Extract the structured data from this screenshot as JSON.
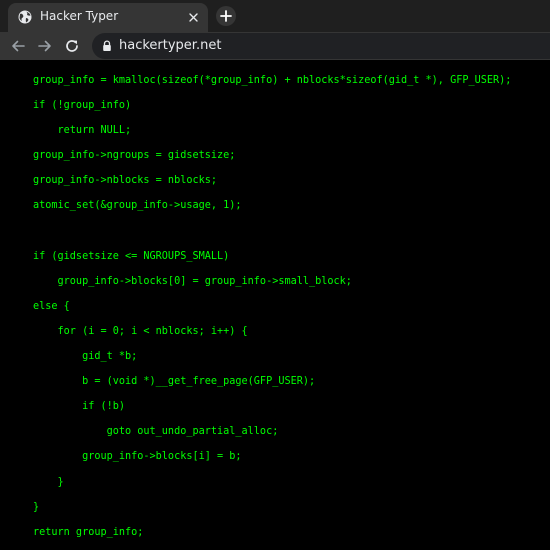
{
  "browser": {
    "tab": {
      "title": "Hacker Typer"
    },
    "address_bar": {
      "url": "hackertyper.net"
    }
  },
  "colors": {
    "code_text": "#00ff00",
    "background": "#000000"
  },
  "icons": {
    "favicon": "globe-icon",
    "tab_close": "close-icon",
    "new_tab": "plus-icon",
    "back": "arrow-left-icon",
    "forward": "arrow-right-icon",
    "reload": "reload-icon",
    "lock": "lock-icon"
  },
  "code_lines": [
    "group_info = kmalloc(sizeof(*group_info) + nblocks*sizeof(gid_t *), GFP_USER);",
    "if (!group_info)",
    "    return NULL;",
    "group_info->ngroups = gidsetsize;",
    "group_info->nblocks = nblocks;",
    "atomic_set(&group_info->usage, 1);",
    "",
    "if (gidsetsize <= NGROUPS_SMALL)",
    "    group_info->blocks[0] = group_info->small_block;",
    "else {",
    "    for (i = 0; i < nblocks; i++) {",
    "        gid_t *b;",
    "        b = (void *)__get_free_page(GFP_USER);",
    "        if (!b)",
    "            goto out_undo_partial_alloc;",
    "        group_info->blocks[i] = b;",
    "    }",
    "}",
    "return group_info;"
  ]
}
